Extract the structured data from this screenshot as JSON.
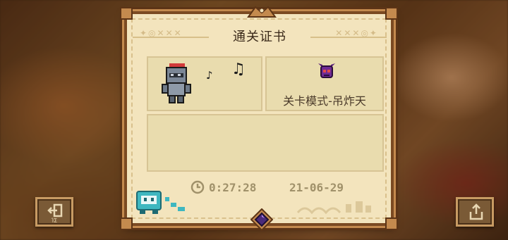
{
  "certificate": {
    "title": "通关证书",
    "mode_label": "关卡模式-吊炸天",
    "clear_time": "0:27:28",
    "date": "21-06-29"
  },
  "buttons": {
    "exit_label": "退出",
    "exit_sub_label": "ΊΣ",
    "share_label": "分享"
  },
  "icons": {
    "music_note": "♪",
    "music_notes": "♫"
  },
  "colors": {
    "paper": "#f3e4bd",
    "panel": "#e9dcae",
    "frame": "#7b4a22",
    "text": "#4a3a2a"
  }
}
